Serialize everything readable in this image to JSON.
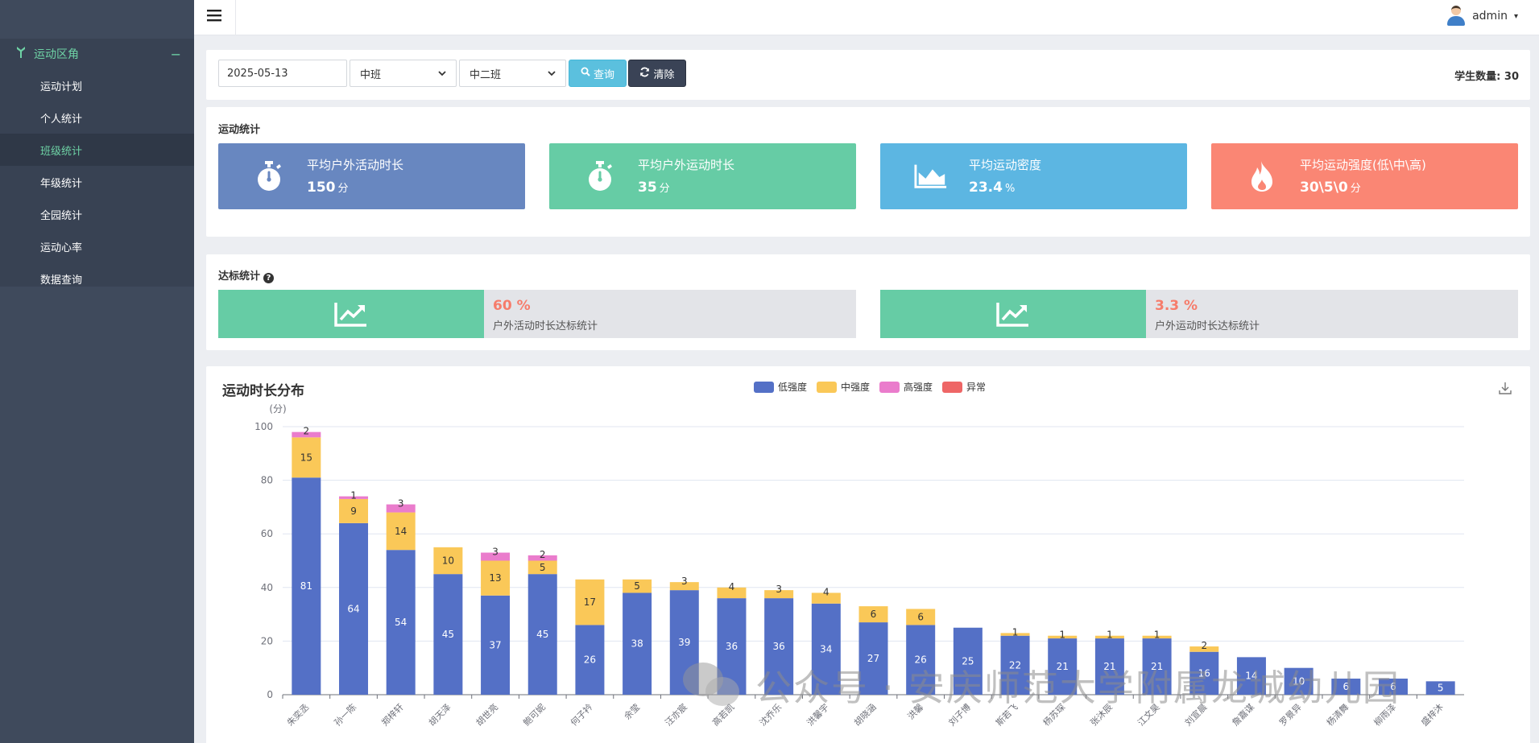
{
  "sidebar": {
    "section_label": "运动区角",
    "collapse_symbol": "−",
    "items": [
      {
        "label": "运动计划",
        "active": false
      },
      {
        "label": "个人统计",
        "active": false
      },
      {
        "label": "班级统计",
        "active": true
      },
      {
        "label": "年级统计",
        "active": false
      },
      {
        "label": "全园统计",
        "active": false
      },
      {
        "label": "运动心率",
        "active": false
      },
      {
        "label": "数据查询",
        "active": false
      }
    ]
  },
  "topbar": {
    "menu_icon": "hamburger-icon",
    "username": "admin"
  },
  "filter": {
    "date": "2025-05-13",
    "grade": "中班",
    "class_name": "中二班",
    "query_label": "查询",
    "clear_label": "清除",
    "student_count": "学生数量: 30"
  },
  "stats": {
    "title": "运动统计",
    "boxes": [
      {
        "label": "平均户外活动时长",
        "value": "150",
        "unit": "分",
        "color": "#6887c0",
        "icon": "stopwatch-icon"
      },
      {
        "label": "平均户外运动时长",
        "value": "35",
        "unit": "分",
        "color": "#66cca5",
        "icon": "stopwatch-icon"
      },
      {
        "label": "平均运动密度",
        "value": "23.4",
        "unit": "%",
        "color": "#5cb6e2",
        "icon": "area-chart-icon"
      },
      {
        "label": "平均运动强度(低\\中\\高)",
        "value": "30\\5\\0",
        "unit": "分",
        "color": "#fa8674",
        "icon": "fire-icon"
      }
    ]
  },
  "reach": {
    "title": "达标统计",
    "boxes": [
      {
        "pct": "60 %",
        "label": "户外活动时长达标统计"
      },
      {
        "pct": "3.3 %",
        "label": "户外运动时长达标统计"
      }
    ]
  },
  "chart_data": {
    "type": "bar",
    "stacked": true,
    "title": "运动时长分布",
    "ylabel": "(分)",
    "ylim": [
      0,
      100
    ],
    "yticks": [
      0,
      20,
      40,
      60,
      80,
      100
    ],
    "grid": true,
    "legend_position": "top-center",
    "categories": [
      "朱奕丞",
      "孙一陈",
      "郑梓轩",
      "胡天泽",
      "胡世亮",
      "鲍可妮",
      "何子衿",
      "余莹",
      "汪亦宸",
      "高若凯",
      "沈乔乐",
      "洪馨宇",
      "胡晓涵",
      "洪馨",
      "刘子博",
      "斯若飞",
      "杨苏琛",
      "张沐辰",
      "江文昊",
      "刘宣晨",
      "詹嘉谋",
      "罗景异",
      "杨清舞",
      "柳雨泽",
      "盛梓沐"
    ],
    "series": [
      {
        "name": "低强度",
        "color": "#5470c6",
        "values": [
          81,
          64,
          54,
          45,
          37,
          45,
          26,
          38,
          39,
          36,
          36,
          34,
          27,
          26,
          25,
          22,
          21,
          21,
          21,
          16,
          14,
          10,
          6,
          6,
          5
        ]
      },
      {
        "name": "中强度",
        "color": "#fac858",
        "values": [
          15,
          9,
          14,
          10,
          13,
          5,
          17,
          5,
          3,
          4,
          3,
          4,
          6,
          6,
          0,
          1,
          1,
          1,
          1,
          2,
          0,
          0,
          0,
          0,
          0
        ]
      },
      {
        "name": "高强度",
        "color": "#ea7ccc",
        "values": [
          2,
          1,
          3,
          0,
          3,
          2,
          0,
          0,
          0,
          0,
          0,
          0,
          0,
          0,
          0,
          0,
          0,
          0,
          0,
          0,
          0,
          0,
          0,
          0,
          0
        ]
      },
      {
        "name": "异常",
        "color": "#ee6666",
        "values": [
          0,
          0,
          0,
          0,
          0,
          0,
          0,
          0,
          0,
          0,
          0,
          0,
          0,
          0,
          0,
          0,
          0,
          0,
          0,
          0,
          0,
          0,
          0,
          0,
          0
        ]
      }
    ]
  },
  "watermark": "公众号 · 安庆师范大学附属龙城幼儿园"
}
